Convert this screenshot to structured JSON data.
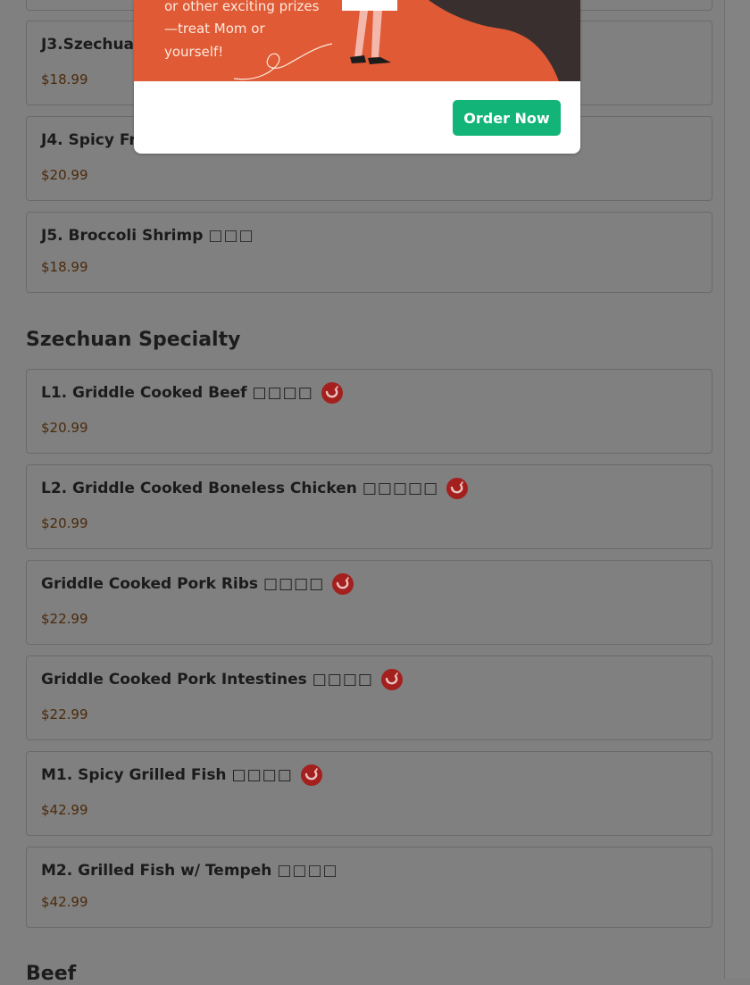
{
  "top_items": [
    {
      "title": "J3.Szechuan",
      "price": "$18.99"
    },
    {
      "title": "J4. Spicy Frie",
      "price": "$20.99"
    },
    {
      "title": "J5. Broccoli Shrimp",
      "chinese": "□□□",
      "price": "$18.99"
    }
  ],
  "szechuan_section": {
    "heading": "Szechuan Specialty",
    "items": [
      {
        "title": "L1. Griddle Cooked Beef",
        "chinese": "□□□□",
        "spicy_icon": "chili-pepper-icon",
        "price": "$20.99"
      },
      {
        "title": "L2. Griddle Cooked Boneless Chicken",
        "chinese": "□□□□□",
        "spicy_icon": "chili-pepper-icon",
        "price": "$20.99"
      },
      {
        "title": "Griddle Cooked Pork Ribs",
        "chinese": "□□□□",
        "spicy_icon": "chili-pepper-icon",
        "price": "$22.99"
      },
      {
        "title": "Griddle Cooked Pork Intestines",
        "chinese": "□□□□",
        "spicy_icon": "chili-pepper-icon",
        "price": "$22.99"
      },
      {
        "title": "M1. Spicy Grilled Fish",
        "chinese": "□□□□",
        "spicy_icon": "chili-pepper-icon",
        "price": "$42.99"
      },
      {
        "title": "M2. Grilled Fish w/ Tempeh",
        "chinese": "□□□□",
        "price": "$42.99"
      }
    ]
  },
  "next_section": {
    "heading": "Beef"
  },
  "promo_modal": {
    "banner_lines": [
      "or other exciting prizes",
      "—treat Mom or",
      "yourself!"
    ],
    "order_button": "Order Now",
    "colors": {
      "banner": "#df5a35",
      "button": "#12b478",
      "overlay": "#808080"
    }
  },
  "colors": {
    "price": "#4c2a0a",
    "chili_badge": "#a3201f"
  }
}
